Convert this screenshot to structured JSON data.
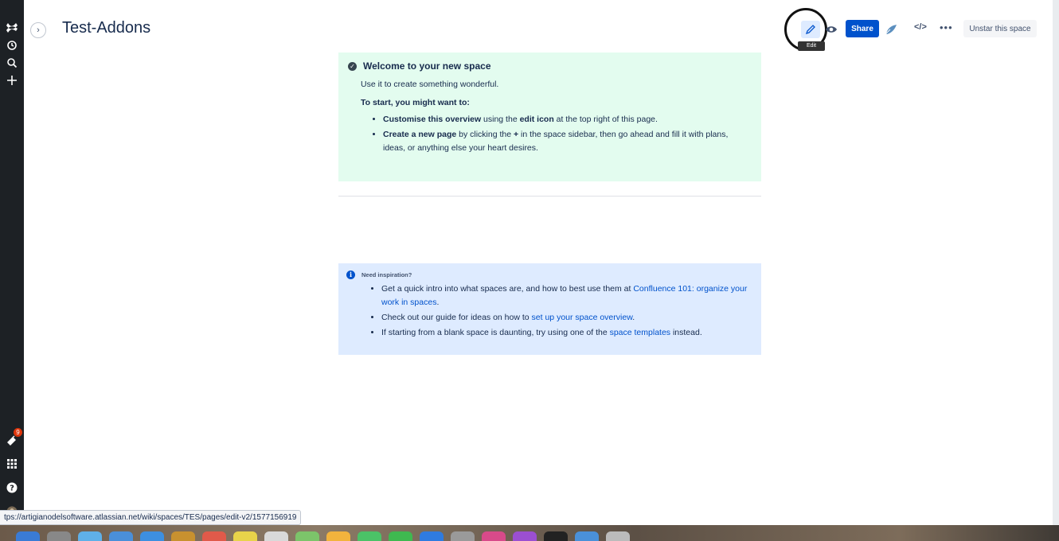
{
  "space": {
    "title": "Test-Addons"
  },
  "toolbar": {
    "edit_tooltip": "Edit",
    "share_label": "Share",
    "code_label": "</>",
    "more_label": "•••",
    "unstar_label": "Unstar this space"
  },
  "rail": {
    "notification_count": "9"
  },
  "welcome": {
    "heading": "Welcome to your new space",
    "intro": "Use it to create something wonderful.",
    "start_heading": "To start, you might want to:",
    "bullet1_bold": "Customise this overview",
    "bullet1_mid": " using the ",
    "bullet1_bold2": "edit icon",
    "bullet1_rest": " at the top right of this page.",
    "bullet2_bold": "Create a new page",
    "bullet2_mid": " by clicking the ",
    "bullet2_bold2": "+",
    "bullet2_rest": " in the space sidebar, then go ahead and fill it with plans, ideas, or anything else your heart desires."
  },
  "inspiration": {
    "heading": "Need inspiration?",
    "item1_text": "Get a quick intro into what spaces are, and how to best use them at ",
    "item1_link": "Confluence 101: organize your work in spaces",
    "item1_end": ".",
    "item2_text": "Check out our guide for ideas on how to ",
    "item2_link": "set up your space overview",
    "item2_end": ".",
    "item3_text": "If starting from a blank space is daunting, try using one of the ",
    "item3_link": "space templates",
    "item3_end": " instead."
  },
  "status_bar": {
    "url": "tps://artigianodelsoftware.atlassian.net/wiki/spaces/TES/pages/edit-v2/1577156919"
  },
  "colors": {
    "rail": "#1d2125",
    "primary": "#0052cc",
    "success_panel": "#e3fcef",
    "info_panel": "#deebff"
  }
}
